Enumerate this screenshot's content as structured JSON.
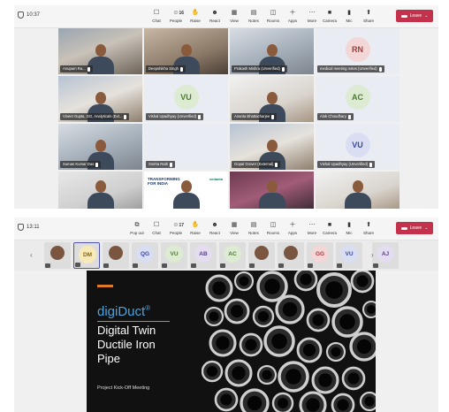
{
  "screenshot1": {
    "time": "10:37",
    "toolbar": {
      "items": [
        {
          "label": "Chat",
          "icon": "chat-icon"
        },
        {
          "label": "People",
          "icon": "people-icon",
          "count": "16"
        },
        {
          "label": "Raise",
          "icon": "hand-icon"
        },
        {
          "label": "React",
          "icon": "react-icon"
        },
        {
          "label": "View",
          "icon": "view-icon"
        },
        {
          "label": "Notes",
          "icon": "notes-icon"
        },
        {
          "label": "Rooms",
          "icon": "rooms-icon"
        },
        {
          "label": "Apps",
          "icon": "apps-icon"
        },
        {
          "label": "More",
          "icon": "more-icon"
        }
      ],
      "devices": [
        {
          "label": "Camera",
          "icon": "camera-icon"
        },
        {
          "label": "Mic",
          "icon": "mic-icon"
        },
        {
          "label": "Share",
          "icon": "share-icon"
        }
      ],
      "leave": "Leave"
    },
    "tiles": [
      {
        "name": "Anupam Ra...",
        "kind": "photo",
        "style": "a"
      },
      {
        "name": "Deepshikha Singh",
        "kind": "photo",
        "style": "b"
      },
      {
        "name": "Prakash Mishra (Unverified)",
        "kind": "photo",
        "style": "c"
      },
      {
        "name": "medical meeting notes (Unverified)",
        "kind": "avatar",
        "initials": "RN",
        "bg": "#f3d6d6",
        "fg": "#a33c3c"
      },
      {
        "name": "Vineet Gupta, GG, Analyticals (Ext...",
        "kind": "photo",
        "style": "d"
      },
      {
        "name": "Vishal Upadhyay (Unverified)",
        "kind": "avatar",
        "initials": "VU",
        "bg": "#dcebd2",
        "fg": "#4d7a32"
      },
      {
        "name": "Ananta Bhattacharjee",
        "kind": "photo",
        "style": "e"
      },
      {
        "name": "Alok Choudhary",
        "kind": "avatar",
        "initials": "AC",
        "bg": "#dcebd2",
        "fg": "#4d7a32"
      },
      {
        "name": "Suman Kumar Das",
        "kind": "photo",
        "style": "c"
      },
      {
        "name": "Sneha Rath",
        "kind": "blank"
      },
      {
        "name": "Gopal Grover (External)",
        "kind": "photo",
        "style": "d"
      },
      {
        "name": "Vishal Upadhyay (Unverified)",
        "kind": "avatar",
        "initials": "VU",
        "bg": "#d9def3",
        "fg": "#3b4a9c"
      },
      {
        "name": "",
        "kind": "photo",
        "style": "g"
      },
      {
        "name": "",
        "kind": "slide",
        "text1": "TRANSFORMING",
        "text2": "FOR INDIA",
        "logo": "vedanta"
      },
      {
        "name": "",
        "kind": "photo",
        "style": "f"
      },
      {
        "name": "",
        "kind": "photo",
        "style": "e"
      }
    ]
  },
  "screenshot2": {
    "time": "13:11",
    "toolbar": {
      "items": [
        {
          "label": "Pop out",
          "icon": "popout-icon"
        },
        {
          "label": "Chat",
          "icon": "chat-icon"
        },
        {
          "label": "People",
          "icon": "people-icon",
          "count": "17"
        },
        {
          "label": "Raise",
          "icon": "hand-icon"
        },
        {
          "label": "React",
          "icon": "react-icon"
        },
        {
          "label": "View",
          "icon": "view-icon"
        },
        {
          "label": "Notes",
          "icon": "notes-icon"
        },
        {
          "label": "Rooms",
          "icon": "rooms-icon"
        },
        {
          "label": "Apps",
          "icon": "apps-icon"
        },
        {
          "label": "More",
          "icon": "more-icon"
        }
      ],
      "devices": [
        {
          "label": "Camera",
          "icon": "camera-icon"
        },
        {
          "label": "Mic",
          "icon": "mic-icon"
        },
        {
          "label": "Share",
          "icon": "share-icon"
        }
      ],
      "leave": "Leave"
    },
    "strip": [
      {
        "kind": "photo"
      },
      {
        "kind": "avatar",
        "initials": "DM",
        "bg": "#f7e9b8",
        "fg": "#8a6a12",
        "selected": true
      },
      {
        "kind": "photo"
      },
      {
        "kind": "avatar",
        "initials": "QG",
        "bg": "#d9def3",
        "fg": "#3b4a9c"
      },
      {
        "kind": "avatar",
        "initials": "VU",
        "bg": "#dcebd2",
        "fg": "#4d7a32"
      },
      {
        "kind": "avatar",
        "initials": "AB",
        "bg": "#e4dcef",
        "fg": "#5b3f8c"
      },
      {
        "kind": "avatar",
        "initials": "AC",
        "bg": "#dcebd2",
        "fg": "#4d7a32"
      },
      {
        "kind": "photo"
      },
      {
        "kind": "photo"
      },
      {
        "kind": "avatar",
        "initials": "GG",
        "bg": "#f3d6d6",
        "fg": "#a33c3c"
      },
      {
        "kind": "avatar",
        "initials": "VU",
        "bg": "#d9def3",
        "fg": "#3b4a9c"
      },
      {
        "kind": "avatar",
        "initials": "AJ",
        "bg": "#e4dcef",
        "fg": "#5b3f8c"
      }
    ],
    "slide": {
      "brand": "digiDuct",
      "reg": "®",
      "subtitle_lines": [
        "Digital Twin",
        "Ductile Iron",
        "Pipe"
      ],
      "footer": "Project Kick-Off Meeting",
      "accent": "#e07a2d",
      "brand_color": "#4aa3df"
    },
    "strip_prev": "‹",
    "strip_next": "›"
  }
}
